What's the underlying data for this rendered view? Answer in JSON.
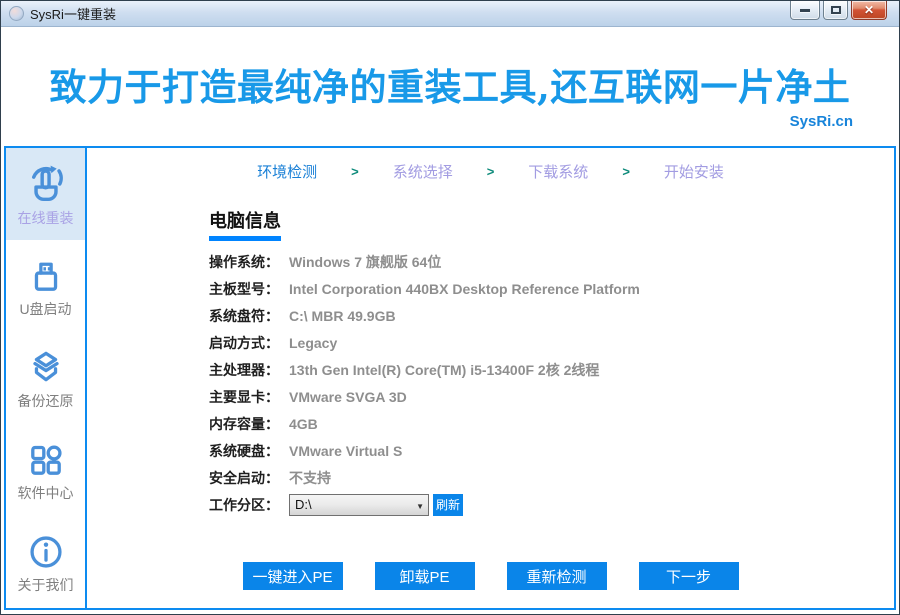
{
  "window": {
    "title": "SysRi一键重装"
  },
  "header": {
    "slogan": "致力于打造最纯净的重装工具,还互联网一片净土",
    "site": "SysRi.cn"
  },
  "sidebar": {
    "items": [
      {
        "label": "在线重装",
        "icon": "hand-refresh-icon",
        "active": true
      },
      {
        "label": "U盘启动",
        "icon": "usb-drive-icon",
        "active": false
      },
      {
        "label": "备份还原",
        "icon": "backup-box-icon",
        "active": false
      },
      {
        "label": "软件中心",
        "icon": "app-grid-icon",
        "active": false
      },
      {
        "label": "关于我们",
        "icon": "info-circle-icon",
        "active": false
      }
    ]
  },
  "steps": {
    "separator": ">",
    "active_index": 0,
    "items": [
      "环境检测",
      "系统选择",
      "下载系统",
      "开始安装"
    ]
  },
  "main": {
    "section_title": "电脑信息",
    "info_rows": [
      {
        "label": "操作系统：",
        "value": "Windows 7 旗舰版  64位"
      },
      {
        "label": "主板型号：",
        "value": "Intel Corporation 440BX Desktop Reference Platform"
      },
      {
        "label": "系统盘符：",
        "value": "C:\\ MBR 49.9GB"
      },
      {
        "label": "启动方式：",
        "value": "Legacy"
      },
      {
        "label": "主处理器：",
        "value": "13th Gen Intel(R) Core(TM) i5-13400F 2核 2线程"
      },
      {
        "label": "主要显卡：",
        "value": "VMware SVGA 3D"
      },
      {
        "label": "内存容量：",
        "value": "4GB"
      },
      {
        "label": "系统硬盘：",
        "value": "VMware Virtual S"
      },
      {
        "label": "安全启动：",
        "value": "不支持"
      }
    ],
    "partition": {
      "label": "工作分区：",
      "selected": "D:\\",
      "dropdown_arrow": "▼",
      "refresh_label": "刷新"
    },
    "buttons": [
      "一键进入PE",
      "卸载PE",
      "重新检测",
      "下一步"
    ]
  },
  "colors": {
    "accent_blue": "#0a85e9",
    "frame_blue": "#0d8bf0",
    "icon_blue": "#4a90d9",
    "slogan_blue": "#1899e8",
    "step_active": "#187fd6",
    "step_inactive": "#a29ce2",
    "step_arrow_teal": "#0d8a7a",
    "active_item_bg": "#d9e8f6",
    "value_gray": "#8e8e8e",
    "underline_blue": "#0084ff"
  }
}
